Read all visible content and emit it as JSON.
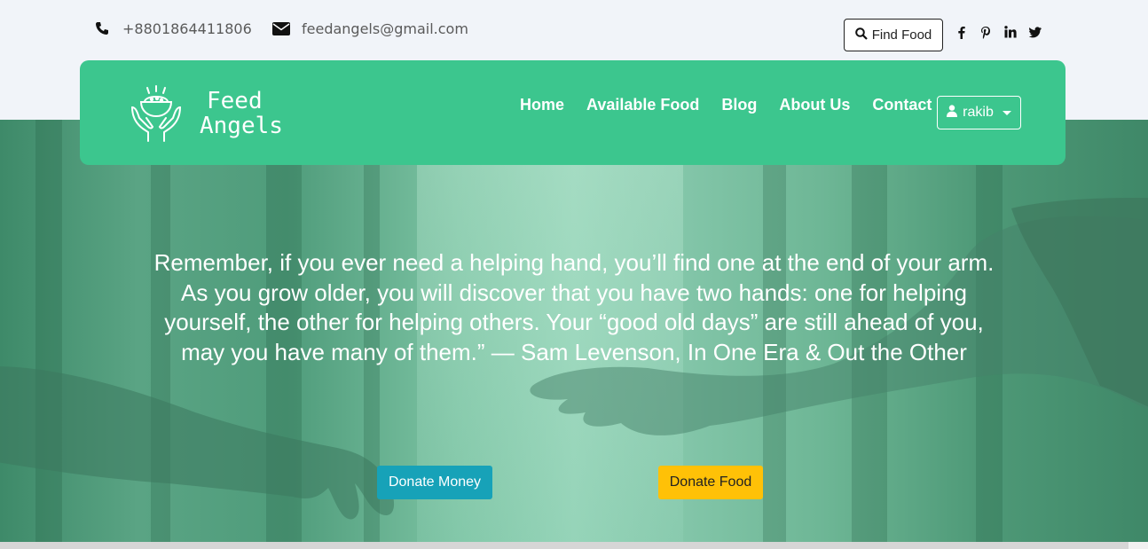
{
  "contact": {
    "phone": "+8801864411806",
    "email": "feedangels@gmail.com"
  },
  "find_food": {
    "label": "Find Food",
    "icon": "search-icon"
  },
  "social": [
    {
      "name": "facebook-icon",
      "glyph": "f"
    },
    {
      "name": "pinterest-icon",
      "glyph": "P"
    },
    {
      "name": "linkedin-icon",
      "glyph": "in"
    },
    {
      "name": "twitter-icon",
      "glyph": "t"
    }
  ],
  "brand": {
    "line1": "Feed",
    "line2": "Angels"
  },
  "nav": {
    "home": "Home",
    "available_food": "Available Food",
    "blog": "Blog",
    "about": "About Us",
    "contact": "Contact"
  },
  "user": {
    "name": "rakib",
    "icon": "user-icon"
  },
  "hero": {
    "quote_line1": "Remember, if you ever need a helping hand, you’ll find one at the end of your arm.",
    "quote_line2": "As you grow older, you will discover that you have two hands: one for helping",
    "quote_line3": "yourself, the other for helping others. Your “good old days” are still ahead of you,",
    "quote_line4": "may you have many of them.” — Sam Levenson, In One Era & Out the Other",
    "donate_money": "Donate Money",
    "donate_food": "Donate Food"
  },
  "colors": {
    "navbar": "#3cc68e",
    "donate_money": "#17a2b8",
    "donate_food": "#ffc107"
  }
}
